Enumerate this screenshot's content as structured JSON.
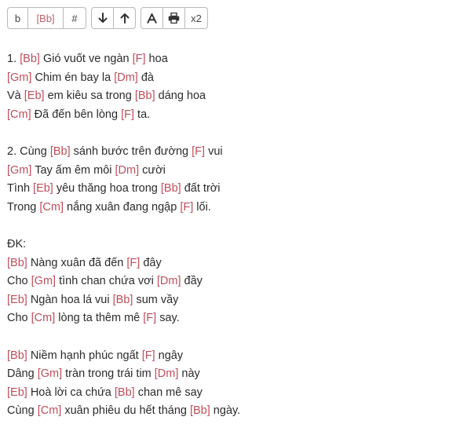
{
  "toolbar": {
    "buttons": [
      {
        "label": "b",
        "icon": null
      },
      {
        "label": "[Bb]",
        "icon": null
      },
      {
        "label": "#",
        "icon": null
      },
      {
        "label": "",
        "icon": "arrow-down-icon"
      },
      {
        "label": "",
        "icon": "arrow-up-icon"
      },
      {
        "label": "",
        "icon": "font-icon"
      },
      {
        "label": "",
        "icon": "print-icon"
      },
      {
        "label": "x2",
        "icon": null
      }
    ],
    "accent_color": "#c0626c"
  },
  "lyrics": [
    {
      "lines": [
        [
          {
            "t": "1. "
          },
          {
            "c": "[Bb]"
          },
          {
            "t": " Gió vuốt ve ngàn "
          },
          {
            "c": "[F]"
          },
          {
            "t": " hoa"
          }
        ],
        [
          {
            "c": "[Gm]"
          },
          {
            "t": " Chim én bay la "
          },
          {
            "c": "[Dm]"
          },
          {
            "t": " đà"
          }
        ],
        [
          {
            "t": "Và "
          },
          {
            "c": "[Eb]"
          },
          {
            "t": " em kiêu sa trong "
          },
          {
            "c": "[Bb]"
          },
          {
            "t": " dáng hoa"
          }
        ],
        [
          {
            "c": "[Cm]"
          },
          {
            "t": " Đã đến bên lòng "
          },
          {
            "c": "[F]"
          },
          {
            "t": " ta."
          }
        ]
      ]
    },
    {
      "lines": [
        [
          {
            "t": "2. Cùng "
          },
          {
            "c": "[Bb]"
          },
          {
            "t": " sánh bước trên đường "
          },
          {
            "c": "[F]"
          },
          {
            "t": " vui"
          }
        ],
        [
          {
            "c": "[Gm]"
          },
          {
            "t": " Tay ấm êm môi "
          },
          {
            "c": "[Dm]"
          },
          {
            "t": " cười"
          }
        ],
        [
          {
            "t": "Tình "
          },
          {
            "c": "[Eb]"
          },
          {
            "t": " yêu thăng hoa trong "
          },
          {
            "c": "[Bb]"
          },
          {
            "t": " đất trời"
          }
        ],
        [
          {
            "t": "Trong "
          },
          {
            "c": "[Cm]"
          },
          {
            "t": " nắng xuân đang ngập "
          },
          {
            "c": "[F]"
          },
          {
            "t": " lối."
          }
        ]
      ]
    },
    {
      "lines": [
        [
          {
            "t": "ĐK:"
          }
        ],
        [
          {
            "c": "[Bb]"
          },
          {
            "t": " Nàng xuân đã đến "
          },
          {
            "c": "[F]"
          },
          {
            "t": " đây"
          }
        ],
        [
          {
            "t": "Cho "
          },
          {
            "c": "[Gm]"
          },
          {
            "t": " tình chan chứa vơi "
          },
          {
            "c": "[Dm]"
          },
          {
            "t": " đầy"
          }
        ],
        [
          {
            "c": "[Eb]"
          },
          {
            "t": " Ngàn hoa lá vui "
          },
          {
            "c": "[Bb]"
          },
          {
            "t": " sum vầy"
          }
        ],
        [
          {
            "t": "Cho "
          },
          {
            "c": "[Cm]"
          },
          {
            "t": " lòng ta thêm mê "
          },
          {
            "c": "[F]"
          },
          {
            "t": " say."
          }
        ]
      ]
    },
    {
      "lines": [
        [
          {
            "c": "[Bb]"
          },
          {
            "t": " Niềm hạnh phúc ngất "
          },
          {
            "c": "[F]"
          },
          {
            "t": " ngây"
          }
        ],
        [
          {
            "t": "Dâng "
          },
          {
            "c": "[Gm]"
          },
          {
            "t": " tràn trong trái tim "
          },
          {
            "c": "[Dm]"
          },
          {
            "t": " này"
          }
        ],
        [
          {
            "c": "[Eb]"
          },
          {
            "t": " Hoà lời ca chứa "
          },
          {
            "c": "[Bb]"
          },
          {
            "t": " chan mê say"
          }
        ],
        [
          {
            "t": "Cùng "
          },
          {
            "c": "[Cm]"
          },
          {
            "t": " xuân phiêu du hết tháng "
          },
          {
            "c": "[Bb]"
          },
          {
            "t": " ngày."
          }
        ]
      ]
    }
  ]
}
